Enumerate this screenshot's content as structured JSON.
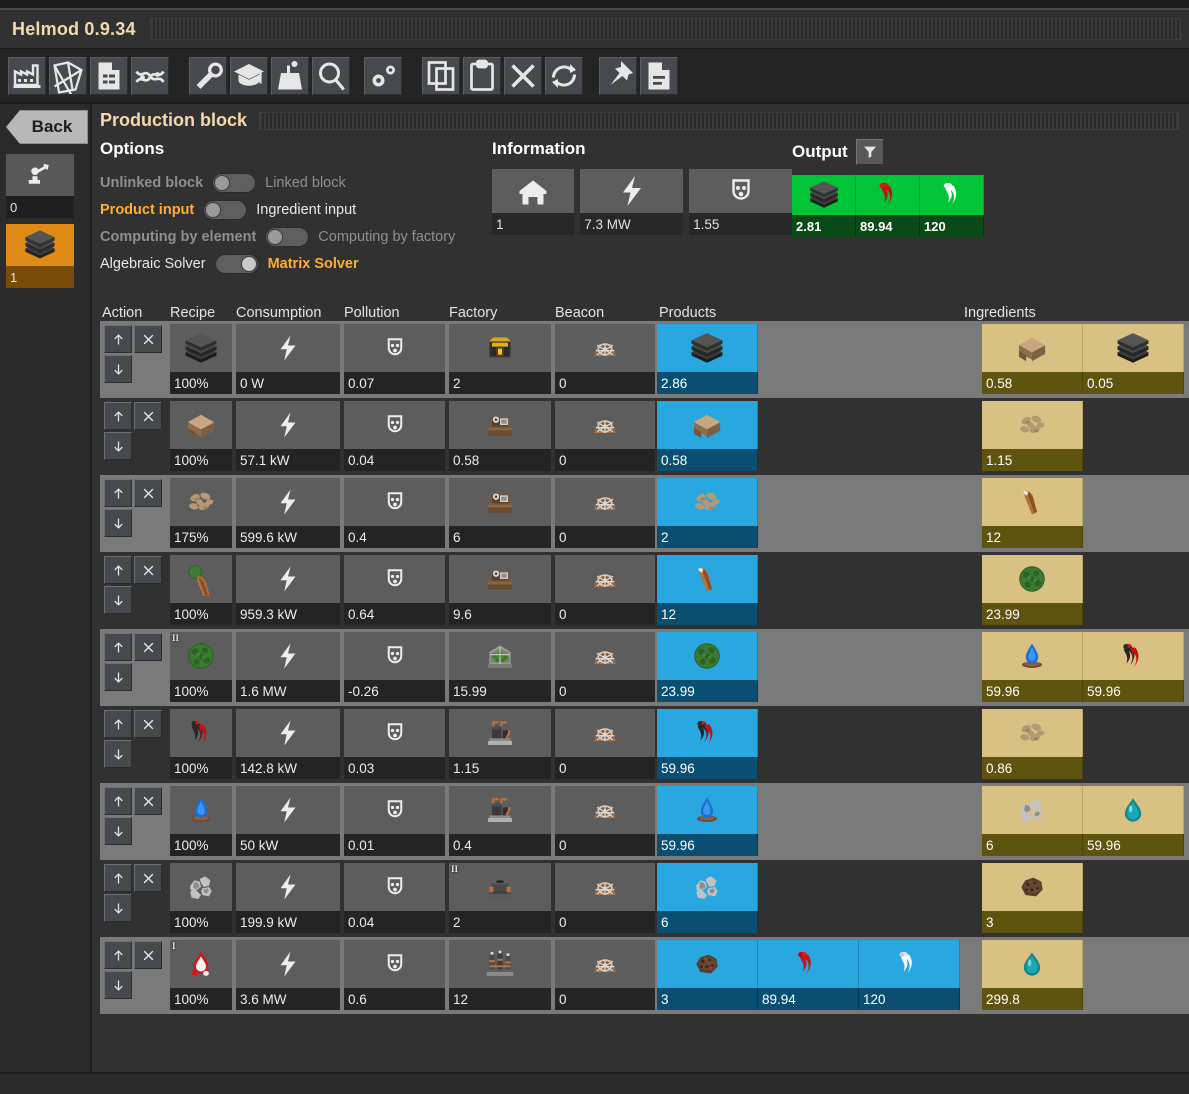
{
  "app": {
    "title": "Helmod 0.9.34"
  },
  "toolbar": {
    "buttons": [
      {
        "name": "production-icon",
        "tooltip": "Production"
      },
      {
        "name": "model-icon",
        "tooltip": "Model"
      },
      {
        "name": "summary-icon",
        "tooltip": "Summary"
      },
      {
        "name": "statistics-icon",
        "tooltip": "Statistics"
      },
      {
        "name": "properties-icon",
        "tooltip": "Properties"
      },
      {
        "name": "technology-icon",
        "tooltip": "Technology"
      },
      {
        "name": "factory-icon",
        "tooltip": "Factory"
      },
      {
        "name": "search-icon",
        "tooltip": "Search"
      },
      {
        "name": "settings-icon",
        "tooltip": "Settings"
      },
      {
        "name": "copy-icon",
        "tooltip": "Copy"
      },
      {
        "name": "paste-icon",
        "tooltip": "Paste"
      },
      {
        "name": "close-icon",
        "tooltip": "Remove"
      },
      {
        "name": "refresh-icon",
        "tooltip": "Refresh"
      },
      {
        "name": "pin-icon",
        "tooltip": "Pin"
      },
      {
        "name": "notes-icon",
        "tooltip": "Notes"
      }
    ]
  },
  "sidebar": {
    "back_label": "Back",
    "tiles": [
      {
        "name": "block-tile-assembly",
        "value": "0",
        "icon": "assembly-machine-icon",
        "selected": false
      },
      {
        "name": "block-tile-plate",
        "value": "1",
        "icon": "steel-plate-icon",
        "selected": true
      }
    ]
  },
  "page": {
    "title": "Production block"
  },
  "options": {
    "title": "Options",
    "rows": [
      {
        "left": "Unlinked block",
        "right": "Linked block",
        "on": false,
        "active_side": "left",
        "left_state": "dim",
        "right_state": "dim"
      },
      {
        "left": "Product input",
        "right": "Ingredient input",
        "on": false,
        "active_side": "left",
        "left_state": "on",
        "right_state": "white"
      },
      {
        "left": "Computing by element",
        "right": "Computing by factory",
        "on": false,
        "active_side": "left",
        "left_state": "dim",
        "right_state": "dim"
      },
      {
        "left": "Algebraic Solver",
        "right": "Matrix Solver",
        "on": true,
        "active_side": "right",
        "left_state": "white",
        "right_state": "on"
      }
    ]
  },
  "information": {
    "title": "Information",
    "tiles": [
      {
        "name": "block-count",
        "icon": "block-icon",
        "value": "1"
      },
      {
        "name": "energy-consumption",
        "icon": "energy-icon",
        "value": "7.3 MW"
      },
      {
        "name": "pollution-total",
        "icon": "pollution-icon",
        "value": "1.55"
      }
    ]
  },
  "output": {
    "title": "Output",
    "filter_icon": "filter-icon",
    "tiles": [
      {
        "name": "output-steel-plate",
        "icon": "steel-plate-icon",
        "value": "2.81"
      },
      {
        "name": "output-petroleum-gas",
        "icon": "petroleum-gas-icon",
        "value": "89.94"
      },
      {
        "name": "output-steam",
        "icon": "steam-icon",
        "value": "120"
      }
    ]
  },
  "table": {
    "columns": [
      "Action",
      "Recipe",
      "Consumption",
      "Pollution",
      "Factory",
      "Beacon",
      "Products",
      "Ingredients"
    ],
    "rows": [
      {
        "highlight": true,
        "recipe": {
          "icon": "steel-plate-icon",
          "value": "100%"
        },
        "consumption": {
          "icon": "energy-icon",
          "value": "0 W"
        },
        "pollution": {
          "icon": "pollution-icon",
          "value": "0.07"
        },
        "factory": {
          "icon": "electric-furnace-icon",
          "value": "2"
        },
        "beacon": {
          "icon": "beacon-icon",
          "value": "0"
        },
        "products": [
          {
            "icon": "steel-plate-icon",
            "value": "2.86"
          }
        ],
        "ingredients": [
          {
            "icon": "iron-plate-icon",
            "value": "0.58"
          },
          {
            "icon": "steel-plate-icon",
            "value": "0.05"
          }
        ]
      },
      {
        "highlight": false,
        "recipe": {
          "icon": "iron-plate-icon",
          "value": "100%"
        },
        "consumption": {
          "icon": "energy-icon",
          "value": "57.1 kW"
        },
        "pollution": {
          "icon": "pollution-icon",
          "value": "0.04"
        },
        "factory": {
          "icon": "assembling-machine-icon",
          "value": "0.58"
        },
        "beacon": {
          "icon": "beacon-icon",
          "value": "0"
        },
        "products": [
          {
            "icon": "iron-plate-icon",
            "value": "0.58"
          }
        ],
        "ingredients": [
          {
            "icon": "iron-ore-icon",
            "value": "1.15"
          }
        ]
      },
      {
        "highlight": true,
        "recipe": {
          "icon": "iron-ore-icon",
          "value": "175%"
        },
        "consumption": {
          "icon": "energy-icon",
          "value": "599.6 kW"
        },
        "pollution": {
          "icon": "pollution-icon",
          "value": "0.4"
        },
        "factory": {
          "icon": "assembling-machine-icon",
          "value": "6"
        },
        "beacon": {
          "icon": "beacon-icon",
          "value": "0"
        },
        "products": [
          {
            "icon": "iron-ore-icon",
            "value": "2"
          }
        ],
        "ingredients": [
          {
            "icon": "wood-icon",
            "value": "12"
          }
        ]
      },
      {
        "highlight": false,
        "recipe": {
          "icon": "wood-plant-icon",
          "value": "100%"
        },
        "consumption": {
          "icon": "energy-icon",
          "value": "959.3 kW"
        },
        "pollution": {
          "icon": "pollution-icon",
          "value": "0.64"
        },
        "factory": {
          "icon": "assembling-machine-icon",
          "value": "9.6"
        },
        "beacon": {
          "icon": "beacon-icon",
          "value": "0"
        },
        "products": [
          {
            "icon": "wood-icon",
            "value": "12"
          }
        ],
        "ingredients": [
          {
            "icon": "seedling-icon",
            "value": "23.99"
          }
        ]
      },
      {
        "highlight": true,
        "recipe": {
          "icon": "seedling-icon",
          "value": "100%",
          "tier": "II"
        },
        "consumption": {
          "icon": "energy-icon",
          "value": "1.6 MW"
        },
        "pollution": {
          "icon": "pollution-icon",
          "value": "-0.26"
        },
        "factory": {
          "icon": "greenhouse-icon",
          "value": "15.99"
        },
        "beacon": {
          "icon": "beacon-icon",
          "value": "0"
        },
        "products": [
          {
            "icon": "seedling-icon",
            "value": "23.99"
          }
        ],
        "ingredients": [
          {
            "icon": "blue-flame-icon",
            "value": "59.96"
          },
          {
            "icon": "dark-smoke-icon",
            "value": "59.96"
          }
        ]
      },
      {
        "highlight": false,
        "recipe": {
          "icon": "dark-smoke-icon",
          "value": "100%"
        },
        "consumption": {
          "icon": "energy-icon",
          "value": "142.8 kW"
        },
        "pollution": {
          "icon": "pollution-icon",
          "value": "0.03"
        },
        "factory": {
          "icon": "chemical-plant-icon",
          "value": "1.15"
        },
        "beacon": {
          "icon": "beacon-icon",
          "value": "0"
        },
        "products": [
          {
            "icon": "dark-smoke-icon",
            "value": "59.96"
          }
        ],
        "ingredients": [
          {
            "icon": "iron-ore-icon",
            "value": "0.86"
          }
        ]
      },
      {
        "highlight": true,
        "recipe": {
          "icon": "blue-flame-icon",
          "value": "100%"
        },
        "consumption": {
          "icon": "energy-icon",
          "value": "50 kW"
        },
        "pollution": {
          "icon": "pollution-icon",
          "value": "0.01"
        },
        "factory": {
          "icon": "chemical-plant-icon",
          "value": "0.4"
        },
        "beacon": {
          "icon": "beacon-icon",
          "value": "0"
        },
        "products": [
          {
            "icon": "blue-flame-icon",
            "value": "59.96"
          }
        ],
        "ingredients": [
          {
            "icon": "stone-icon",
            "value": "6"
          },
          {
            "icon": "water-icon",
            "value": "59.96"
          }
        ]
      },
      {
        "highlight": false,
        "recipe": {
          "icon": "stone-icon",
          "value": "100%"
        },
        "consumption": {
          "icon": "energy-icon",
          "value": "199.9 kW"
        },
        "pollution": {
          "icon": "pollution-icon",
          "value": "0.04"
        },
        "factory": {
          "icon": "crusher-icon",
          "value": "2",
          "tier": "II"
        },
        "beacon": {
          "icon": "beacon-icon",
          "value": "0"
        },
        "products": [
          {
            "icon": "stone-icon",
            "value": "6"
          }
        ],
        "ingredients": [
          {
            "icon": "coal-ore-icon",
            "value": "3"
          }
        ]
      },
      {
        "highlight": true,
        "recipe": {
          "icon": "red-flame-icon",
          "value": "100%",
          "tier": "I"
        },
        "consumption": {
          "icon": "energy-icon",
          "value": "3.6 MW"
        },
        "pollution": {
          "icon": "pollution-icon",
          "value": "0.6"
        },
        "factory": {
          "icon": "refinery-icon",
          "value": "12"
        },
        "beacon": {
          "icon": "beacon-icon",
          "value": "0"
        },
        "products": [
          {
            "icon": "coal-ore-icon",
            "value": "3"
          },
          {
            "icon": "petroleum-gas-icon",
            "value": "89.94"
          },
          {
            "icon": "steam-icon",
            "value": "120"
          }
        ],
        "ingredients": [
          {
            "icon": "water-icon",
            "value": "299.8"
          }
        ]
      }
    ]
  }
}
